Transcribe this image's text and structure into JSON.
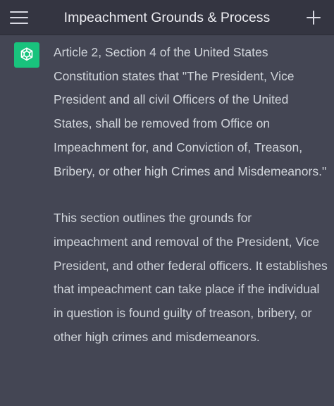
{
  "header": {
    "title": "Impeachment Grounds & Process",
    "menu_icon": "hamburger-menu-icon",
    "new_chat_icon": "plus-icon"
  },
  "message": {
    "avatar_icon": "openai-logo-icon",
    "avatar_color": "#19c37d",
    "paragraphs": [
      "Article 2, Section 4 of the United States Constitution states that \"The President, Vice President and all civil Officers of the United States, shall be removed from Office on Impeachment for, and Conviction of, Treason, Bribery, or other high Crimes and Misdemeanors.\"",
      "This section outlines the grounds for impeachment and removal of the President, Vice President, and other federal officers. It establishes that impeachment can take place if the individual in question is found guilty of treason, bribery, or other high crimes and misdemeanors."
    ]
  },
  "colors": {
    "header_bg": "#343541",
    "message_bg": "#444654",
    "text": "#d1d5db"
  }
}
